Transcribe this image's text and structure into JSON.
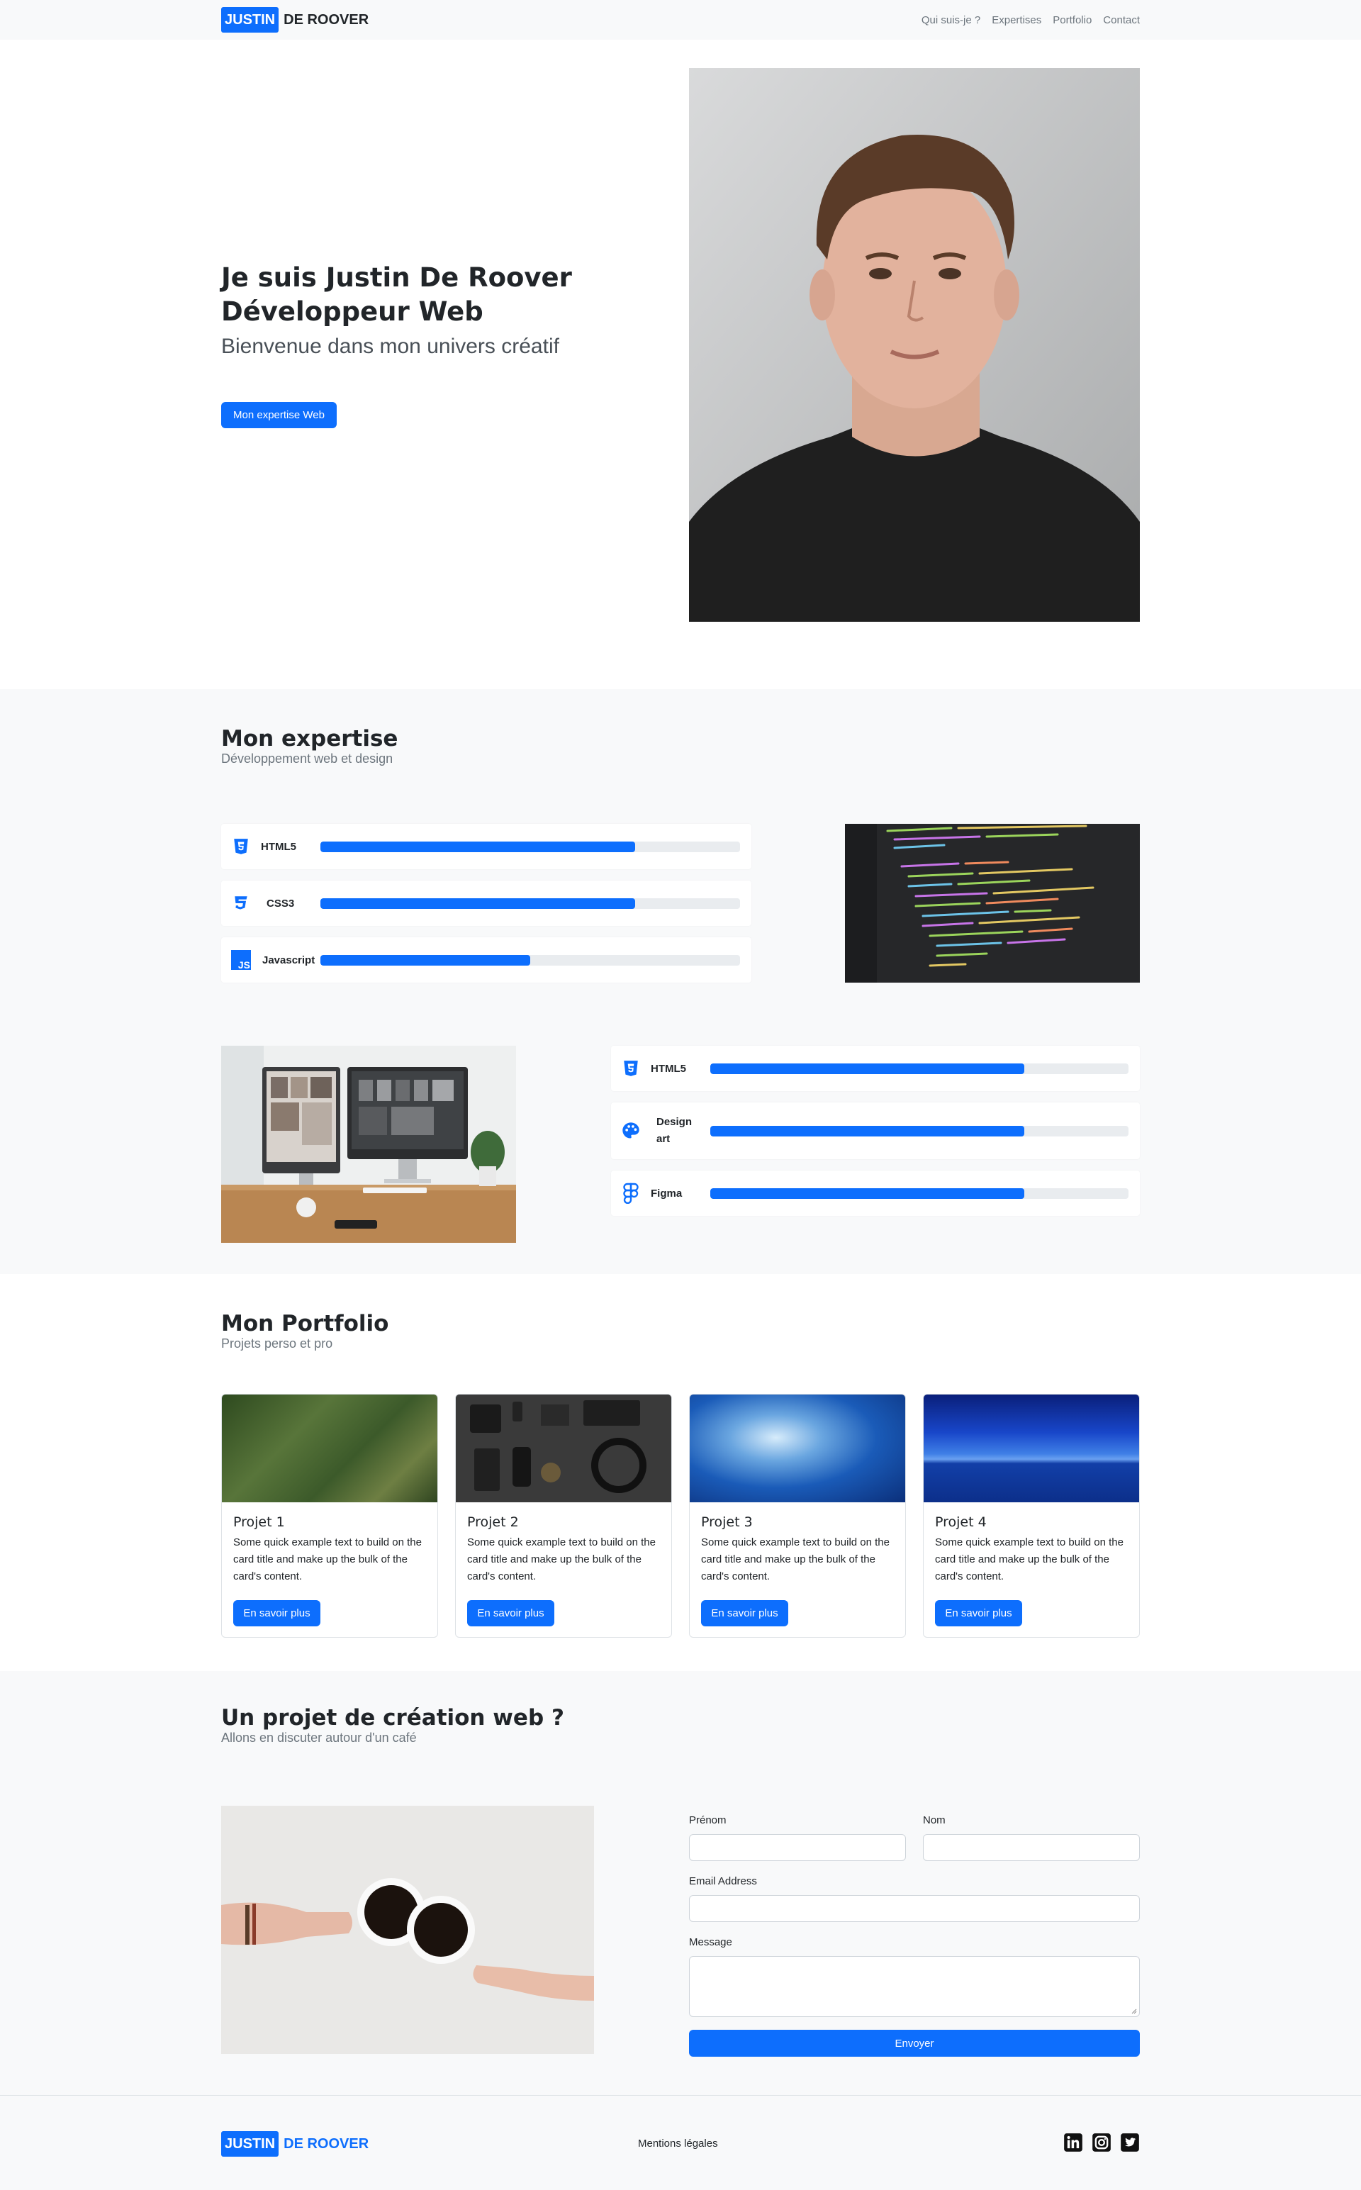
{
  "nav": {
    "logo_box": "JUSTIN",
    "logo_rest": "DE ROOVER",
    "links": [
      "Qui suis-je ?",
      "Expertises",
      "Portfolio",
      "Contact"
    ]
  },
  "hero": {
    "title_line1": "Je suis Justin De Roover",
    "title_line2": "Développeur Web",
    "subtitle": "Bienvenue dans mon univers créatif",
    "cta": "Mon expertise Web"
  },
  "expertise": {
    "title": "Mon expertise",
    "subtitle": "Développement web et design",
    "skills_a": [
      {
        "label": "HTML5",
        "icon": "html5-icon",
        "level": 75
      },
      {
        "label": "CSS3",
        "icon": "css3-icon",
        "level": 75
      },
      {
        "label": "Javascript",
        "icon": "javascript-icon",
        "level": 50
      }
    ],
    "skills_b": [
      {
        "label": "HTML5",
        "icon": "html5-icon",
        "level": 75
      },
      {
        "label": "Design",
        "label2": "art",
        "icon": "palette-icon",
        "level": 75
      },
      {
        "label": "Figma",
        "icon": "figma-icon",
        "level": 75
      }
    ],
    "icon_js_text": "JS"
  },
  "portfolio": {
    "title": "Mon Portfolio",
    "subtitle": "Projets perso et pro",
    "cards": [
      {
        "title": "Projet 1",
        "text": "Some quick example text to build on the card title and make up the bulk of the card's content.",
        "button": "En savoir plus"
      },
      {
        "title": "Projet 2",
        "text": "Some quick example text to build on the card title and make up the bulk of the card's content.",
        "button": "En savoir plus"
      },
      {
        "title": "Projet 3",
        "text": "Some quick example text to build on the card title and make up the bulk of the card's content.",
        "button": "En savoir plus"
      },
      {
        "title": "Projet 4",
        "text": "Some quick example text to build on the card title and make up the bulk of the card's content.",
        "button": "En savoir plus"
      }
    ]
  },
  "contact": {
    "title": "Un projet de création web ?",
    "subtitle": "Allons en discuter autour d'un café",
    "firstname_label": "Prénom",
    "lastname_label": "Nom",
    "email_label": "Email Address",
    "message_label": "Message",
    "submit": "Envoyer"
  },
  "footer": {
    "logo_box": "JUSTIN",
    "logo_rest": "DE ROOVER",
    "legal": "Mentions légales",
    "socials": [
      "linkedin-icon",
      "instagram-icon",
      "twitter-icon"
    ]
  },
  "colors": {
    "primary": "#0d6efd",
    "light_bg": "#f8f9fa",
    "bar_bg": "#e9ecef"
  }
}
